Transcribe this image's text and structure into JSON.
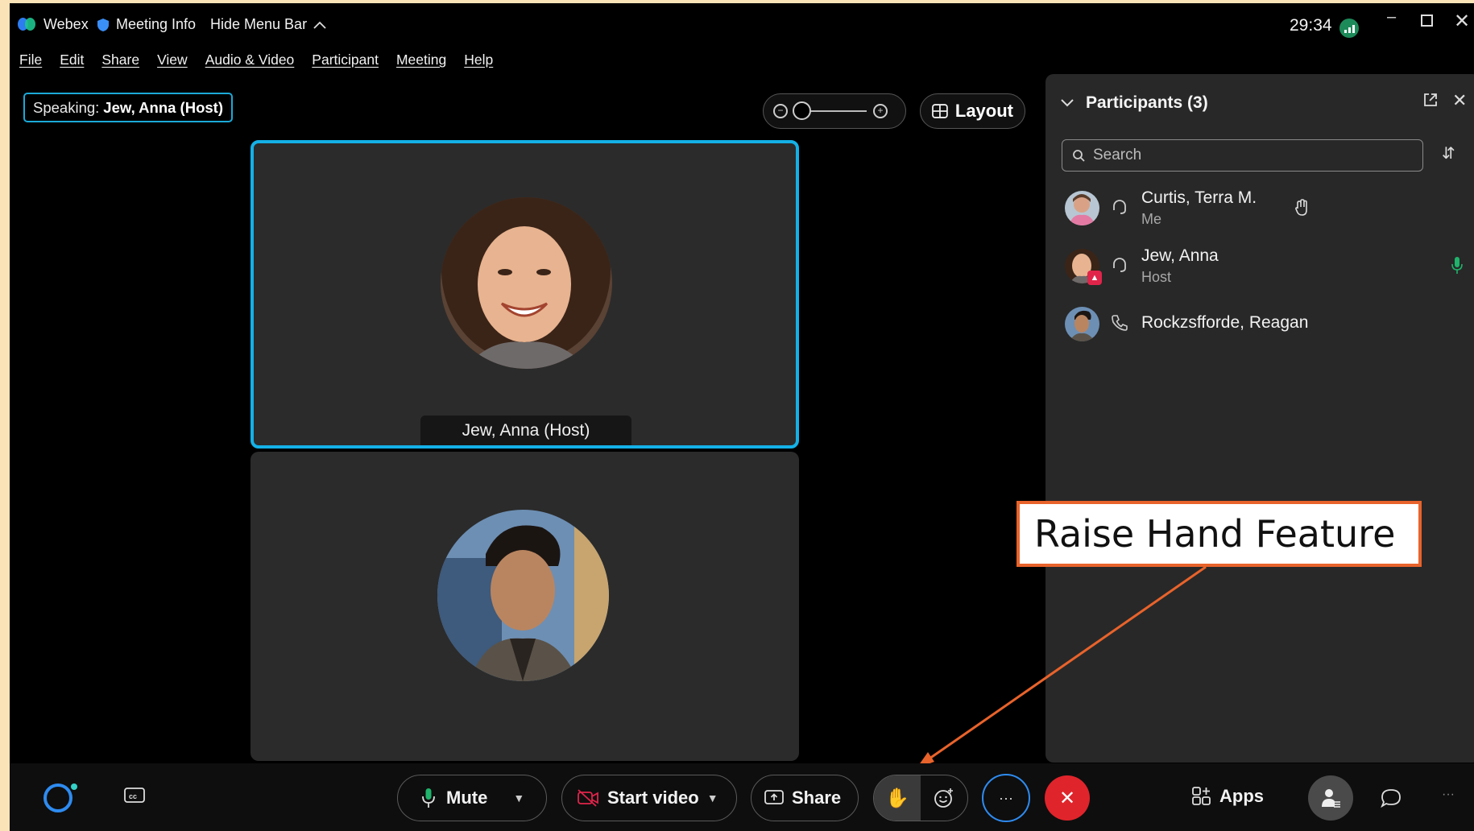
{
  "titlebar": {
    "app_name": "Webex",
    "meeting_info": "Meeting Info",
    "hide_menu": "Hide Menu Bar",
    "timer": "29:34"
  },
  "menu": {
    "items": [
      "File",
      "Edit",
      "Share",
      "View",
      "Audio & Video",
      "Participant",
      "Meeting",
      "Help"
    ]
  },
  "speaking": {
    "prefix": "Speaking:",
    "name": "Jew, Anna (Host)"
  },
  "layout_label": "Layout",
  "tiles": [
    {
      "label": "Jew, Anna  (Host)"
    }
  ],
  "participants": {
    "title": "Participants (3)",
    "search_placeholder": "Search",
    "list": [
      {
        "name": "Curtis, Terra M.",
        "role": "Me"
      },
      {
        "name": "Jew, Anna",
        "role": "Host"
      },
      {
        "name": "Rockzsfforde, Reagan",
        "role": ""
      }
    ]
  },
  "callout": "Raise Hand Feature",
  "toolbar": {
    "mute": "Mute",
    "start_video": "Start video",
    "share": "Share",
    "more": "···",
    "apps": "Apps"
  },
  "colors": {
    "accent": "#14b1e7",
    "end_call": "#e0242b",
    "callout_border": "#e8632b",
    "raise_hand": "#f5a623"
  }
}
